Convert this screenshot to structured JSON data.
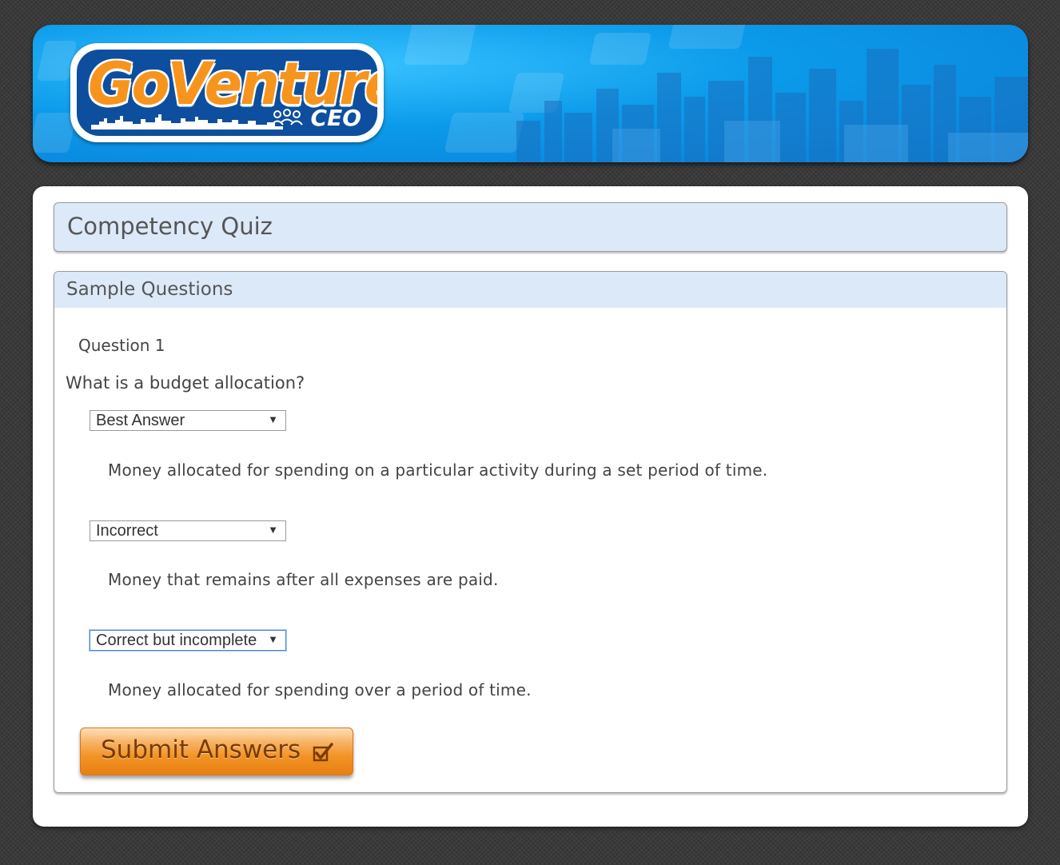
{
  "brand": {
    "name": "GoVenture",
    "edition": "CEO"
  },
  "quiz": {
    "title": "Competency Quiz"
  },
  "section": {
    "title": "Sample Questions"
  },
  "question": {
    "number_label": "Question 1",
    "text": "What is a budget allocation?",
    "answers": [
      {
        "selected_option": "Best Answer",
        "text": "Money allocated for spending on a particular activity during a set period of time."
      },
      {
        "selected_option": "Incorrect",
        "text": "Money that remains after all expenses are paid."
      },
      {
        "selected_option": "Correct but incomplete",
        "text": "Money allocated for spending over a period of time."
      }
    ]
  },
  "submit": {
    "label": "Submit Answers",
    "icon": "checkbox-check-icon"
  },
  "colors": {
    "banner_blue": "#0b9aea",
    "logo_orange": "#f7941d",
    "header_fill": "#dce9f8",
    "button_orange": "#f39426"
  }
}
